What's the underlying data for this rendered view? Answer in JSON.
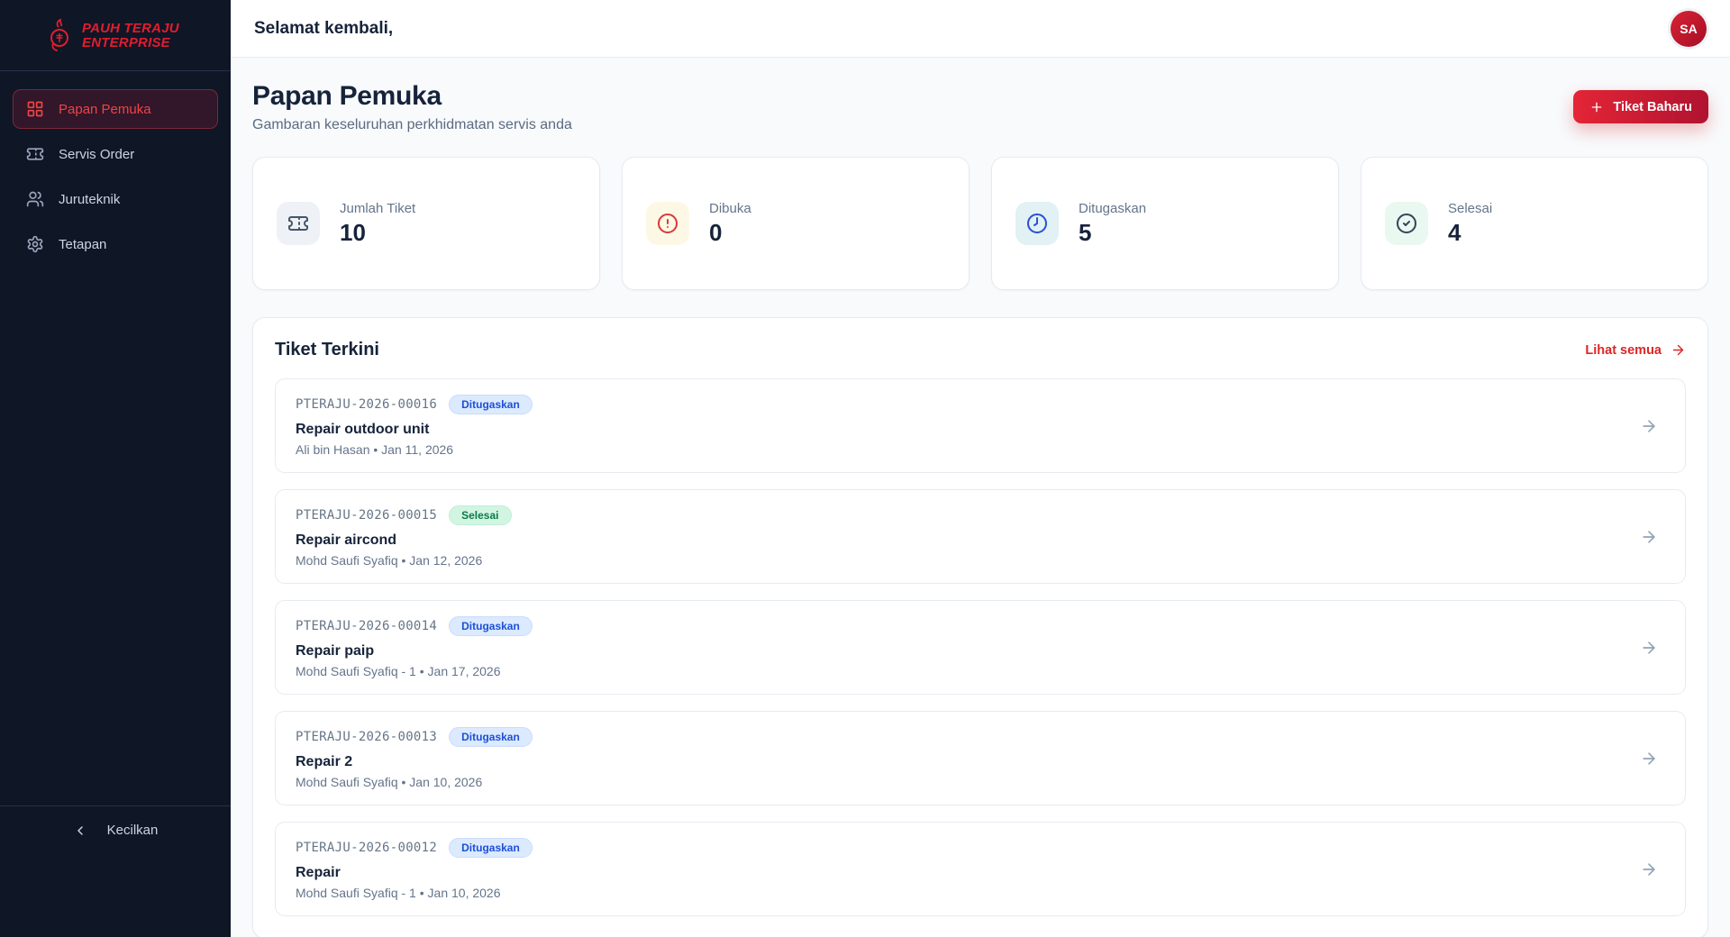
{
  "brand": {
    "line1": "PAUH TERAJU",
    "line2": "ENTERPRISE"
  },
  "sidebar": {
    "items": [
      {
        "label": "Papan Pemuka",
        "icon": "dashboard-grid-icon",
        "active": true
      },
      {
        "label": "Servis Order",
        "icon": "ticket-icon",
        "active": false
      },
      {
        "label": "Juruteknik",
        "icon": "users-icon",
        "active": false
      },
      {
        "label": "Tetapan",
        "icon": "gear-icon",
        "active": false
      }
    ],
    "collapse_label": "Kecilkan"
  },
  "topbar": {
    "greeting": "Selamat kembali,",
    "avatar_initials": "SA"
  },
  "page": {
    "title": "Papan Pemuka",
    "subtitle": "Gambaran keseluruhan perkhidmatan servis anda",
    "new_ticket_label": "Tiket Baharu"
  },
  "stats": [
    {
      "label": "Jumlah Tiket",
      "value": "10",
      "icon": "ticket-icon"
    },
    {
      "label": "Dibuka",
      "value": "0",
      "icon": "alert-circle-icon"
    },
    {
      "label": "Ditugaskan",
      "value": "5",
      "icon": "clock-icon"
    },
    {
      "label": "Selesai",
      "value": "4",
      "icon": "check-circle-icon"
    }
  ],
  "tickets": {
    "title": "Tiket Terkini",
    "view_all_label": "Lihat semua",
    "items": [
      {
        "id": "PTERAJU-2026-00016",
        "status": "Ditugaskan",
        "status_type": "assigned",
        "title": "Repair outdoor unit",
        "meta": "Ali bin Hasan • Jan 11, 2026"
      },
      {
        "id": "PTERAJU-2026-00015",
        "status": "Selesai",
        "status_type": "done",
        "title": "Repair aircond",
        "meta": "Mohd Saufi Syafiq • Jan 12, 2026"
      },
      {
        "id": "PTERAJU-2026-00014",
        "status": "Ditugaskan",
        "status_type": "assigned",
        "title": "Repair paip",
        "meta": "Mohd Saufi Syafiq - 1 • Jan 17, 2026"
      },
      {
        "id": "PTERAJU-2026-00013",
        "status": "Ditugaskan",
        "status_type": "assigned",
        "title": "Repair 2",
        "meta": "Mohd Saufi Syafiq • Jan 10, 2026"
      },
      {
        "id": "PTERAJU-2026-00012",
        "status": "Ditugaskan",
        "status_type": "assigned",
        "title": "Repair",
        "meta": "Mohd Saufi Syafiq - 1 • Jan 10, 2026"
      }
    ]
  },
  "colors": {
    "brand_red": "#e11d2e",
    "sidebar_bg": "#0f1626",
    "active_item_text": "#ef4444",
    "badge_assigned_bg": "#dbeafe",
    "badge_assigned_text": "#1d4fd8",
    "badge_done_bg": "#d2f5e2",
    "badge_done_text": "#0a7a4b",
    "page_bg": "#f8fafc"
  }
}
